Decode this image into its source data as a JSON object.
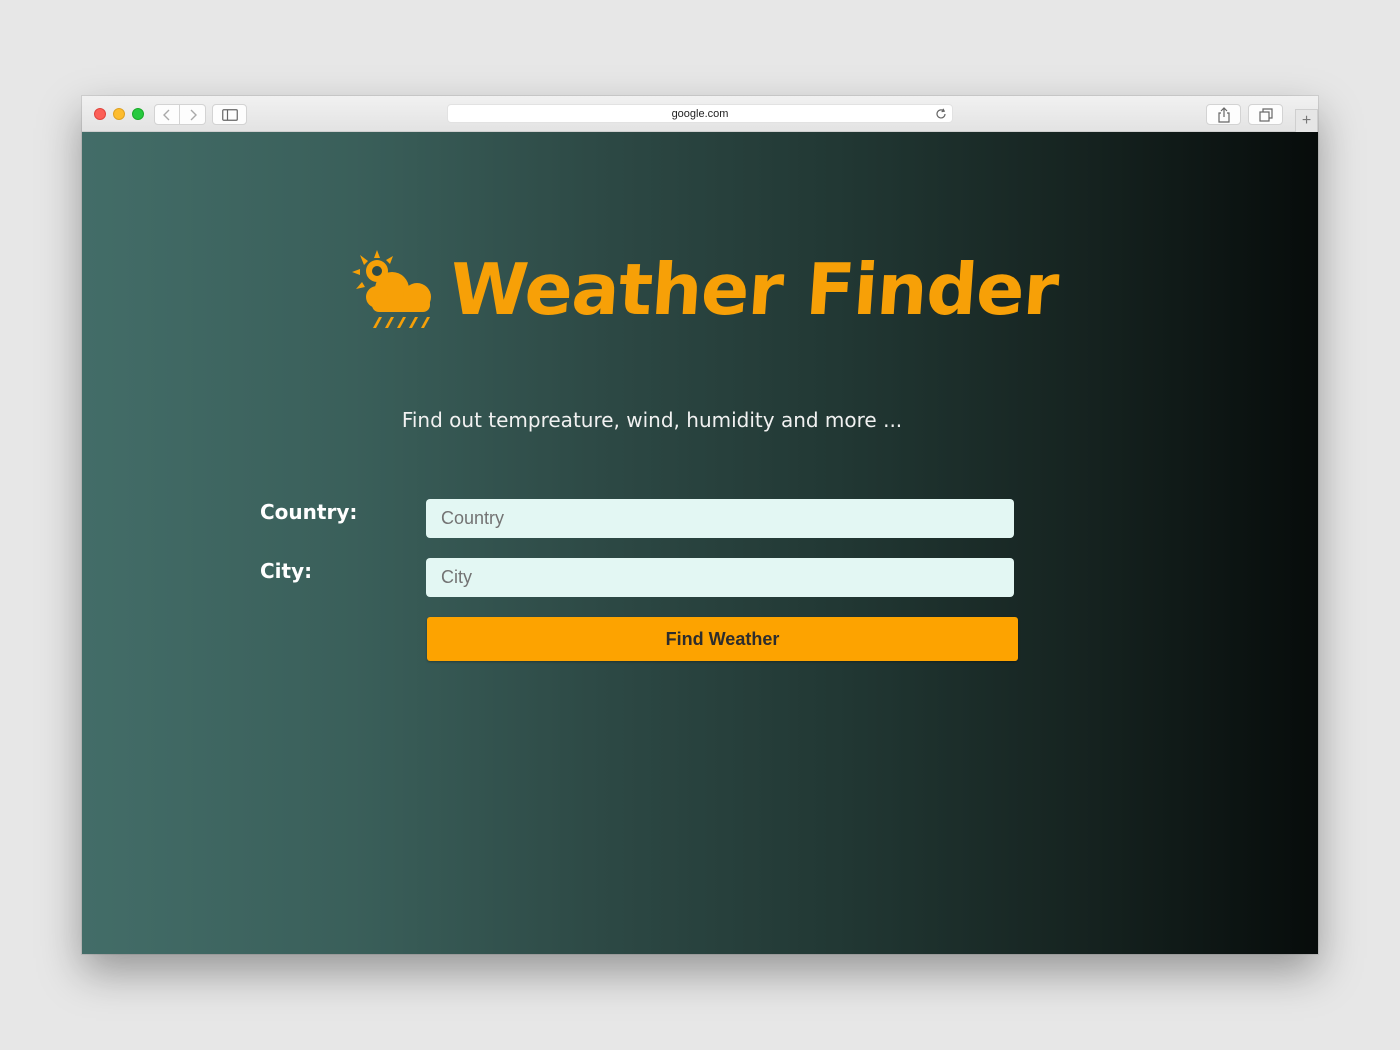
{
  "browser": {
    "url": "google.com",
    "new_tab_label": "+"
  },
  "brand": {
    "title": "Weather Finder",
    "logo_icon": "sun-cloud-rain-icon",
    "accent_color": "#f7a007"
  },
  "tagline": "Find out tempreature, wind, humidity and more ...",
  "form": {
    "country_label": "Country:",
    "country_placeholder": "Country",
    "city_label": "City:",
    "city_placeholder": "City",
    "submit_label": "Find Weather",
    "button_color": "#fda300"
  }
}
